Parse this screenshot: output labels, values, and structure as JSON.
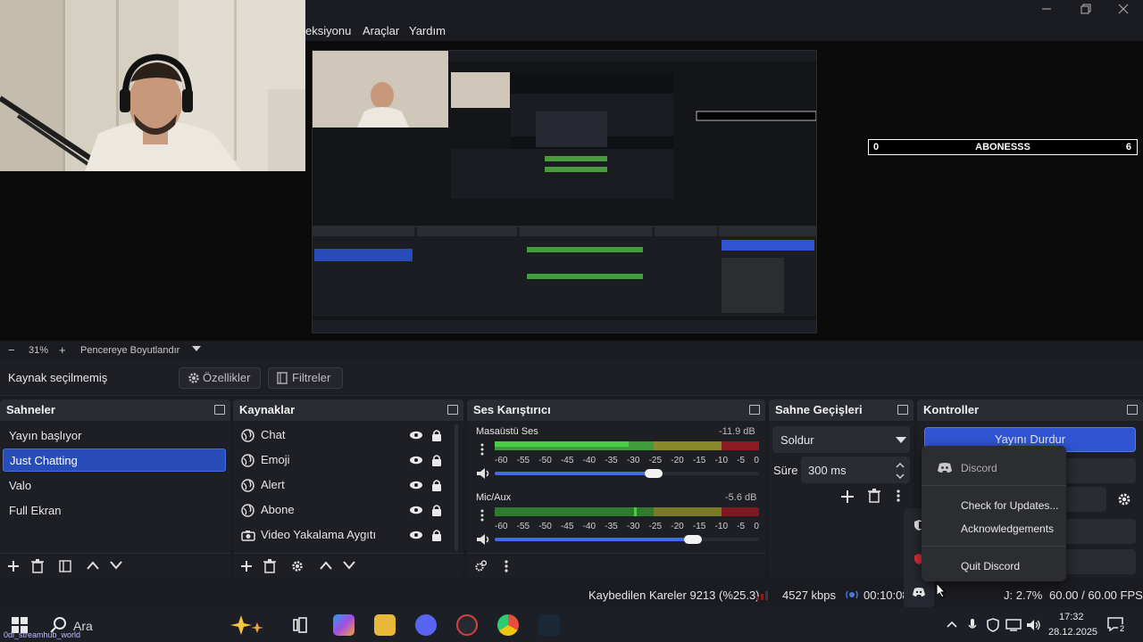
{
  "menubar": {
    "items": [
      "eksiyonu",
      "Araçlar",
      "Yardım"
    ]
  },
  "nested": {
    "menu": [
      "eksiyonu",
      "Araçlar",
      "Yardım"
    ],
    "subbar_name": "ABONESSS",
    "context": "Kaynak seçilmemiş",
    "ctx_props": "Özellikler",
    "ctx_filters": "Filtreler",
    "scenes_title": "Sahneler",
    "sources_title": "Kaynaklar",
    "mixer_title": "Ses Karıştırıcı",
    "trans_title": "Sahne Geçişleri",
    "controls_title": "Kontroller",
    "scenes": [
      "Yayın başlıyor",
      "Just Chatting",
      "Valo",
      "Full Ekran"
    ],
    "sources": [
      "Chat",
      "Emoji",
      "Alert",
      "Abone",
      "Video Yakalama Aygıtı"
    ],
    "mixer_a": "Masaüstü Ses",
    "mixer_a_db": "-11.9 dB",
    "mixer_b": "Mic/Aux",
    "mixer_b_db": "-5.6 dB",
    "trans": "Soldur",
    "dur_label": "Süre",
    "dur": "300 ms",
    "stop_btn": "Yayını Durdur",
    "menu_discord": "Discord",
    "menu_check": "Check for Updates...",
    "menu_ack": "Acknowledgements",
    "menu_quit": "Quit Discord",
    "status": "Kaybedilen Kareler 9213 (%25.3)",
    "kbps": "4527 kbps",
    "fps": "60.00 / 60.00 FPS",
    "tb_search": "Ara",
    "time": "17:32",
    "date": "28.12.2025",
    "zoom": "31%",
    "zoom_mode": "Pencereye Boyutlandır"
  },
  "sub_bar": {
    "left": "0",
    "name": "ABONESSS",
    "right": "6"
  },
  "zoombar": {
    "minus": "−",
    "zoom": "31%",
    "plus": "+",
    "mode": "Pencereye Boyutlandır"
  },
  "context": {
    "label": "Kaynak seçilmemiş",
    "properties": "Özellikler",
    "filters": "Filtreler"
  },
  "scenes": {
    "title": "Sahneler",
    "items": [
      "Yayın başlıyor",
      "Just Chatting",
      "Valo",
      "Full Ekran"
    ],
    "selected": 1
  },
  "sources": {
    "title": "Kaynaklar",
    "items": [
      {
        "name": "Chat",
        "icon": "browser-icon"
      },
      {
        "name": "Emoji",
        "icon": "browser-icon"
      },
      {
        "name": "Alert",
        "icon": "browser-icon"
      },
      {
        "name": "Abone",
        "icon": "browser-icon"
      },
      {
        "name": "Video Yakalama Aygıtı",
        "icon": "camera-icon"
      }
    ]
  },
  "mixer": {
    "title": "Ses Karıştırıcı",
    "channels": [
      {
        "name": "Masaüstü Ses",
        "db": "-11.9 dB",
        "volume": 0.6
      },
      {
        "name": "Mic/Aux",
        "db": "-5.6 dB",
        "volume": 0.75
      }
    ],
    "ticks": [
      "-60",
      "-55",
      "-50",
      "-45",
      "-40",
      "-35",
      "-30",
      "-25",
      "-20",
      "-15",
      "-10",
      "-5",
      "0"
    ]
  },
  "transitions": {
    "title": "Sahne Geçişleri",
    "selected": "Soldur",
    "duration_label": "Süre",
    "duration": "300 ms"
  },
  "controls": {
    "title": "Kontroller",
    "stop_stream": "Yayını Durdur"
  },
  "tray_menu": {
    "title": "Discord",
    "check_updates": "Check for Updates...",
    "acknowledgements": "Acknowledgements",
    "quit": "Quit Discord"
  },
  "status": {
    "dropped": "Kaybedilen Kareler 9213 (%25.3)",
    "bitrate": "4527 kbps",
    "timer": "00:10:08",
    "cpu": "J: 2.7%",
    "fps": "60.00 / 60.00 FPS"
  },
  "taskbar": {
    "search": "Ara",
    "user_tag": "0di_streamhub_world",
    "time": "17:32",
    "date": "28.12.2025",
    "notif_count": "2"
  }
}
